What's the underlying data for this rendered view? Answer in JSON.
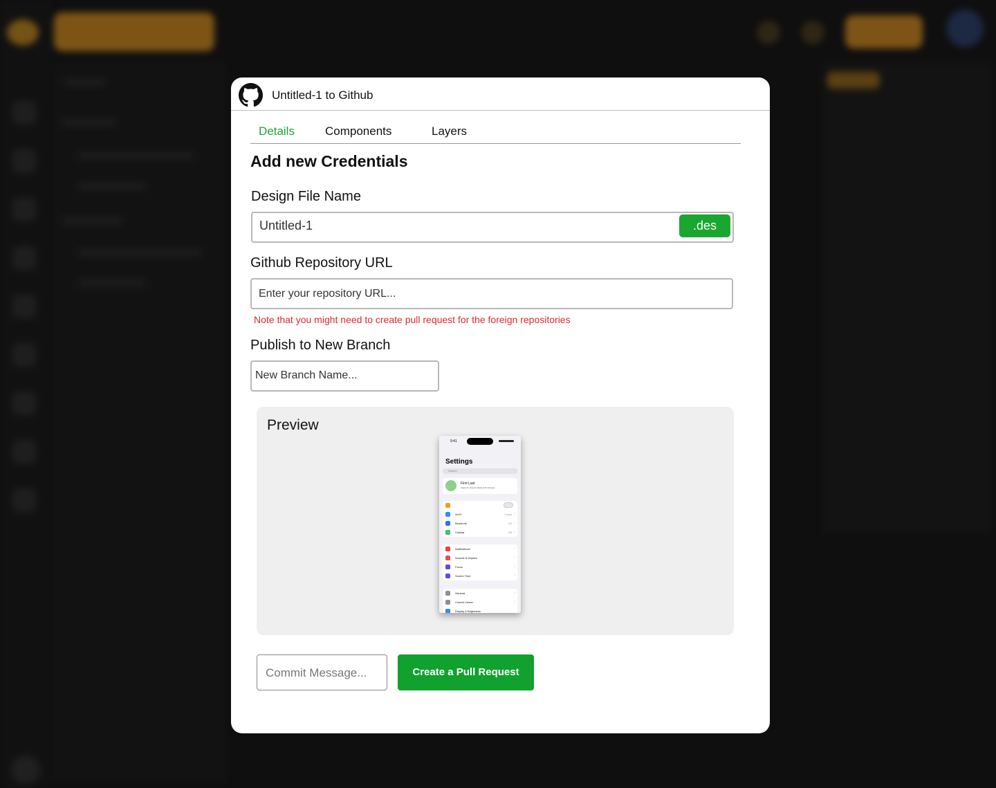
{
  "modal": {
    "title": "Untitled-1 to Github",
    "tabs": [
      {
        "label": "Details",
        "active": true
      },
      {
        "label": "Components",
        "active": false
      },
      {
        "label": "Layers",
        "active": false
      }
    ],
    "section_title": "Add new Credentials",
    "design_file": {
      "label": "Design File Name",
      "value": "Untitled-1",
      "extension": ".des"
    },
    "repo": {
      "label": "Github Repository URL",
      "placeholder": "Enter your repository URL...",
      "note": "Note that you might need to create pull request for the foreign repositories"
    },
    "branch": {
      "label": "Publish to New Branch",
      "placeholder": "New Branch Name..."
    },
    "preview": {
      "title": "Preview",
      "phone": {
        "time": "9:41",
        "screen_title": "Settings",
        "search": "Search",
        "profile_name": "First Last",
        "profile_sub": "Apple ID, iCloud, Media & Purchases",
        "rows": [
          {
            "label": "",
            "value": "",
            "color": "#f59b1b"
          },
          {
            "label": "Wi-Fi",
            "value": "Guest",
            "color": "#2f8cf5"
          },
          {
            "label": "Bluetooth",
            "value": "On",
            "color": "#2f6ff5"
          },
          {
            "label": "Cellular",
            "value": "Off",
            "color": "#36c759"
          },
          {
            "label": "Notifications",
            "value": "",
            "color": "#f23b3b"
          },
          {
            "label": "Sounds & Haptics",
            "value": "",
            "color": "#f2445a"
          },
          {
            "label": "Focus",
            "value": "",
            "color": "#5a4fd6"
          },
          {
            "label": "Screen Time",
            "value": "",
            "color": "#5a4fd6"
          },
          {
            "label": "General",
            "value": "",
            "color": "#8e8e93"
          },
          {
            "label": "Control Center",
            "value": "",
            "color": "#8e8e93"
          },
          {
            "label": "Display & Brightness",
            "value": "",
            "color": "#2f8cf5"
          }
        ]
      }
    },
    "commit_placeholder": "Commit Message...",
    "pr_button": "Create a Pull Request",
    "colors": {
      "accent": "#1fa33a",
      "button": "#11a12e",
      "note": "#e0282c"
    }
  }
}
